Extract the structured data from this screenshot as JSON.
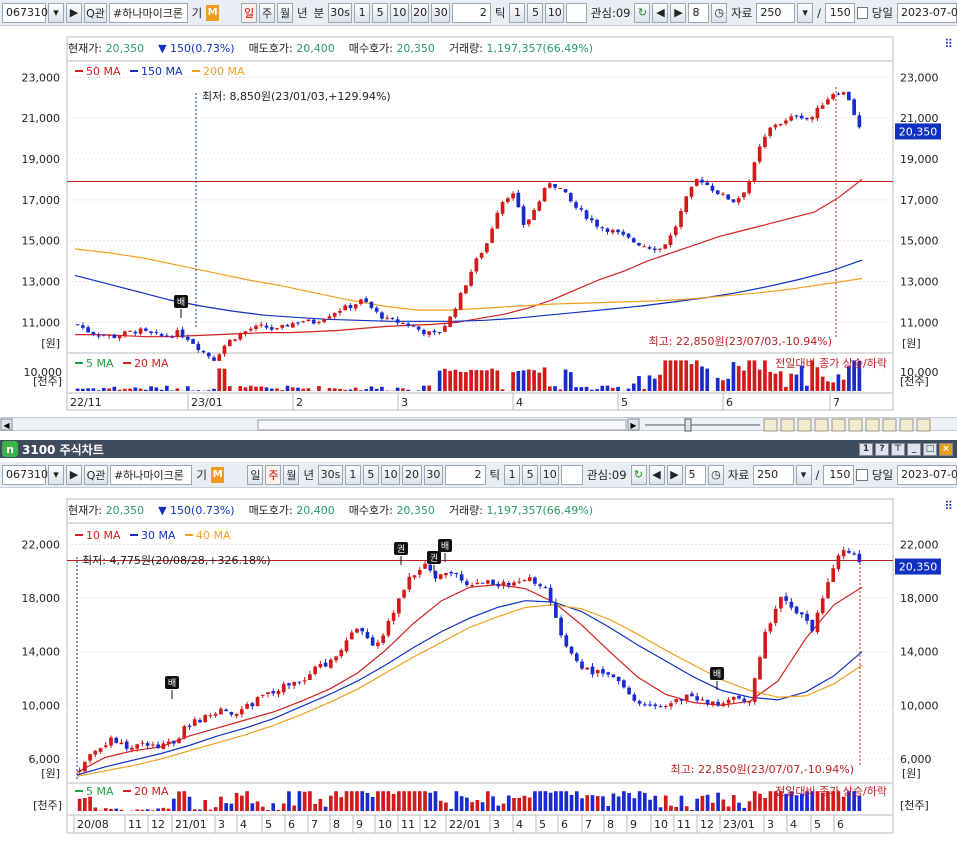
{
  "toolbar": {
    "code": "067310",
    "nav_arrow": "▶",
    "search_label": "Q관",
    "stock_name": "#하나마이크론",
    "stock_badge": "기",
    "m_badge": "M",
    "periods": [
      "일",
      "주",
      "월",
      "년"
    ],
    "minute_label": "분",
    "minute_sel": "30s",
    "minute_opts": [
      "1",
      "5",
      "10",
      "20",
      "30"
    ],
    "tick_value": "2",
    "tick_label": "틱",
    "tick_opts": [
      "1",
      "5",
      "10"
    ],
    "watch_label": "관심:09",
    "data_label": "자료",
    "data_value": "250",
    "slash": "/",
    "date_label": "당일",
    "date_value": "2023-07-0"
  },
  "panel1": {
    "toolbar": {
      "active_period": "일",
      "step_value": "8",
      "count_value": "150"
    },
    "info": {
      "price_label": "현재가:",
      "price": "20,350",
      "change": "▼ 150(0.73%)",
      "ask_label": "매도호가:",
      "ask": "20,400",
      "bid_label": "매수호가:",
      "bid": "20,350",
      "vol_label": "거래량:",
      "vol": "1,197,357(66.49%)"
    },
    "ma_legend": [
      {
        "label": "50 MA",
        "color": "#d32020"
      },
      {
        "label": "150 MA",
        "color": "#1030c0"
      },
      {
        "label": "200 MA",
        "color": "#f0a020"
      }
    ],
    "vol_legend": [
      {
        "label": "5 MA",
        "color": "#20a040"
      },
      {
        "label": "20 MA",
        "color": "#d32020"
      }
    ],
    "low_note": "최저: 8,850원(23/01/03,+129.94%)",
    "high_note": "최고: 22,850원(23/07/03,-10.94%)",
    "vol_note": "전일대비 종가 상승/하락",
    "price_unit": "[원]",
    "vol_unit": "[천주]",
    "vol_tick": "10,000",
    "current_price_tag": "20,350",
    "marker": "배"
  },
  "panel2": {
    "window_title": "3100 주식차트",
    "toolbar": {
      "active_period": "주",
      "step_value": "5",
      "count_value": "150"
    },
    "info": {
      "price_label": "현재가:",
      "price": "20,350",
      "change": "▼ 150(0.73%)",
      "ask_label": "매도호가:",
      "ask": "20,400",
      "bid_label": "매수호가:",
      "bid": "20,350",
      "vol_label": "거래량:",
      "vol": "1,197,357(66.49%)"
    },
    "ma_legend": [
      {
        "label": "10 MA",
        "color": "#d32020"
      },
      {
        "label": "30 MA",
        "color": "#1030c0"
      },
      {
        "label": "40 MA",
        "color": "#f0a020"
      }
    ],
    "vol_legend": [
      {
        "label": "5 MA",
        "color": "#20a040"
      },
      {
        "label": "20 MA",
        "color": "#d32020"
      }
    ],
    "low_note": "최저: 4,775원(20/08/28,+326.18%)",
    "high_note": "최고: 22,850원(23/07/07,-10.94%)",
    "vol_note": "전일대비 종가 상승/하락",
    "price_unit": "[원]",
    "vol_unit": "[천주]",
    "current_price_tag": "20,350",
    "markers": [
      "배",
      "권",
      "권",
      "배",
      "배"
    ]
  },
  "chart_data": [
    {
      "type": "candlestick",
      "title": "",
      "period": "daily",
      "y_ticks": [
        11000,
        13000,
        15000,
        17000,
        19000,
        21000,
        23000
      ],
      "ylim": [
        9500,
        23800
      ],
      "x_ticks": [
        "22/11",
        "23/01",
        "2",
        "3",
        "4",
        "5",
        "6",
        "7"
      ],
      "reference_line": 17900,
      "current_price": 20350,
      "price_path": [
        10900,
        10500,
        10400,
        10300,
        10500,
        10600,
        10400,
        10300,
        10500,
        10200,
        9600,
        9200,
        10000,
        10400,
        10700,
        10800,
        10600,
        10900,
        11100,
        11000,
        11300,
        11600,
        11800,
        12100,
        11500,
        11100,
        11000,
        10800,
        10500,
        10400,
        11200,
        12500,
        13900,
        14900,
        16800,
        17400,
        15700,
        16700,
        17900,
        17500,
        16700,
        16200,
        15700,
        15500,
        15200,
        14900,
        14700,
        14600,
        15400,
        17000,
        18100,
        17600,
        17200,
        16900,
        17700,
        19600,
        20700,
        20800,
        21200,
        20900,
        21700,
        22300,
        22200,
        20500
      ],
      "series": [
        {
          "name": "50 MA",
          "path": [
            10400,
            10400,
            10350,
            10300,
            10300,
            10350,
            10400,
            10450,
            10500,
            10500,
            10550,
            10600,
            10700,
            10800,
            10850,
            10900,
            11000,
            11200,
            11400,
            11700,
            12100,
            12600,
            13100,
            13500,
            14000,
            14400,
            14800,
            15200,
            15500,
            15800,
            16100,
            16400,
            17100,
            18000
          ]
        },
        {
          "name": "150 MA",
          "path": [
            13300,
            12900,
            12500,
            12100,
            11800,
            11550,
            11350,
            11250,
            11150,
            11100,
            11050,
            11050,
            11050,
            11100,
            11200,
            11350,
            11500,
            11650,
            11800,
            12000,
            12200,
            12450,
            12750,
            13100,
            13500,
            14050
          ]
        },
        {
          "name": "200 MA",
          "path": [
            14600,
            14400,
            14150,
            13800,
            13450,
            13100,
            12800,
            12450,
            12100,
            11800,
            11600,
            11600,
            11700,
            11800,
            11900,
            11950,
            12000,
            12050,
            12150,
            12300,
            12450,
            12650,
            12900,
            13150
          ]
        }
      ]
    },
    {
      "type": "candlestick",
      "title": "",
      "period": "weekly",
      "y_ticks": [
        6000,
        10000,
        14000,
        18000,
        22000
      ],
      "ylim": [
        4200,
        23600
      ],
      "x_ticks": [
        "20/08",
        "11",
        "12",
        "21/01",
        "3",
        "4",
        "5",
        "6",
        "7",
        "8",
        "9",
        "10",
        "11",
        "12",
        "22/01",
        "3",
        "4",
        "5",
        "6",
        "7",
        "8",
        "9",
        "10",
        "11",
        "12",
        "23/01",
        "3",
        "4",
        "5",
        "6"
      ],
      "reference_line": 20800,
      "current_price": 20350,
      "price_path": [
        5000,
        6800,
        7400,
        6800,
        7200,
        6800,
        7200,
        8600,
        9100,
        9700,
        9200,
        10100,
        10800,
        11400,
        11600,
        12700,
        13100,
        14700,
        15900,
        14300,
        16700,
        19200,
        20600,
        19500,
        20000,
        19000,
        19200,
        19000,
        19100,
        19400,
        18400,
        14500,
        12900,
        12500,
        12400,
        11100,
        10000,
        9800,
        10200,
        10700,
        10300,
        10000,
        10400,
        10300,
        15500,
        18200,
        17000,
        15700,
        19300,
        21800,
        20800
      ],
      "series": [
        {
          "name": "10 MA",
          "path": [
            5000,
            6100,
            6600,
            6900,
            7700,
            8300,
            8900,
            9500,
            10300,
            11200,
            12400,
            14100,
            16100,
            17800,
            18800,
            19000,
            18700,
            17700,
            16000,
            14000,
            12100,
            10800,
            10200,
            10000,
            10300,
            11800,
            15000,
            17500,
            18800
          ]
        },
        {
          "name": "30 MA",
          "path": [
            4800,
            5400,
            5900,
            6400,
            7000,
            7700,
            8300,
            9000,
            9900,
            10800,
            11800,
            13000,
            14300,
            15500,
            16500,
            17300,
            17800,
            17700,
            17000,
            15800,
            14500,
            13300,
            12100,
            11100,
            10600,
            10400,
            11000,
            12200,
            14000
          ]
        },
        {
          "name": "40 MA",
          "path": [
            4700,
            5100,
            5500,
            6000,
            6600,
            7200,
            7800,
            8500,
            9300,
            10200,
            11200,
            12400,
            13600,
            14700,
            15800,
            16600,
            17300,
            17500,
            17200,
            16400,
            15300,
            14100,
            13000,
            11900,
            11100,
            10600,
            10700,
            11600,
            13000
          ]
        }
      ]
    }
  ]
}
